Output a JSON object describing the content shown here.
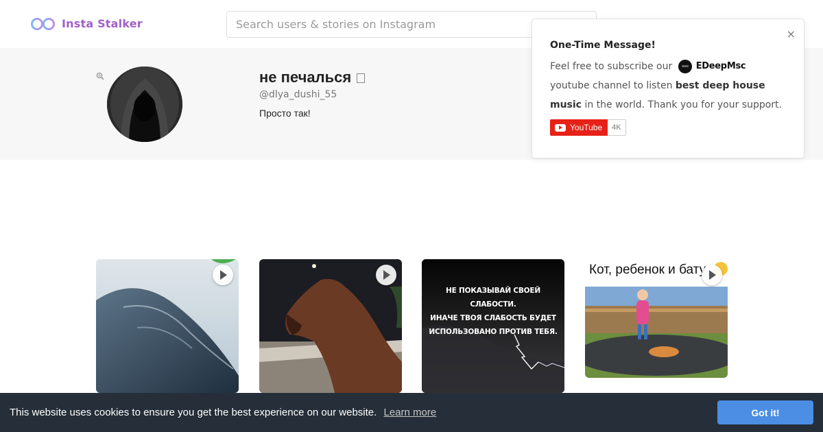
{
  "header": {
    "brand": "Insta Stalker",
    "search_placeholder": "Search users & stories on Instagram"
  },
  "profile": {
    "name": "не печалься",
    "handle": "@dlya_dushi_55",
    "bio": "Просто так!"
  },
  "popup": {
    "title": "One-Time Message!",
    "text_before": "Feel free to subscribe our",
    "channel_name": "EDeepMsc",
    "text_middle": "youtube channel to listen",
    "highlight": "best deep house music",
    "text_after": "in the world. Thank you for your support.",
    "youtube_label": "YouTube",
    "youtube_count": "4K",
    "close_symbol": "×"
  },
  "posts": [
    {
      "kind": "video",
      "caption": ""
    },
    {
      "kind": "video",
      "caption": ""
    },
    {
      "kind": "image",
      "caption": "НЕ ПОКАЗЫВАЙ СВОЕЙ СЛАБОСТИ.\nИНАЧЕ ТВОЯ СЛАБОСТЬ БУДЕТ\nИСПОЛЬЗОВАНО ПРОТИВ ТЕБЯ."
    },
    {
      "kind": "video",
      "caption": "Кот, ребенок и бату"
    }
  ],
  "cookie": {
    "message": "This website uses cookies to ensure you get the best experience on our website.",
    "link_label": "Learn more",
    "button_label": "Got it!"
  },
  "colors": {
    "brand": "#a25fc9",
    "cookie_bar": "#252e39",
    "cookie_button": "#4b8ee3",
    "youtube_red": "#e62117"
  }
}
